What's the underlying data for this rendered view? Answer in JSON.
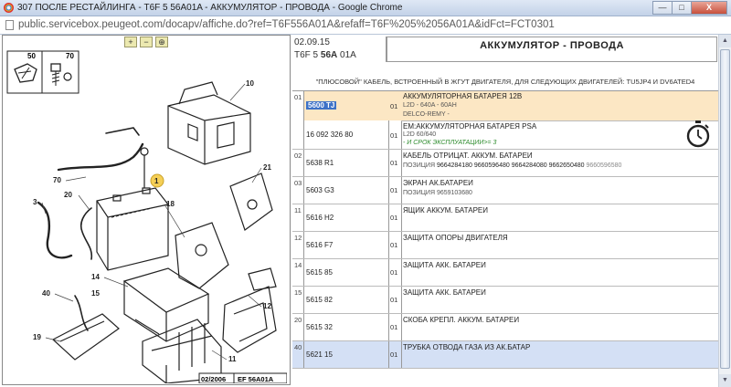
{
  "window": {
    "title": "307 ПОСЛЕ РЕСТАЙЛИНГА - T6F 5 56A01A - АККУМУЛЯТОР - ПРОВОДА - Google Chrome",
    "minimize": "—",
    "maximize": "□",
    "close": "X"
  },
  "address": {
    "url": "public.servicebox.peugeot.com/docapv/affiche.do?ref=T6F556A01A&refaff=T6F%205%2056A01A&idFct=FCT0301"
  },
  "zoom": {
    "zoom_in": "+",
    "zoom_out": "−",
    "reset": "⊕"
  },
  "diagram": {
    "inset_labels": [
      "50",
      "70"
    ],
    "callouts": [
      "10",
      "1",
      "21",
      "70",
      "3",
      "20",
      "18",
      "40",
      "14",
      "15",
      "19",
      "12",
      "11"
    ],
    "footer_date": "02/2006",
    "footer_code": "EF 56A01A"
  },
  "header": {
    "date": "02.09.15",
    "code_prefix": "T6F 5 ",
    "code_bold": "56A",
    "code_suffix": " 01A",
    "title": "АККУМУЛЯТОР - ПРОВОДА"
  },
  "subtitle": "\"ПЛЮСОВОЙ\" КАБЕЛЬ, ВСТРОЕННЫЙ В ЖГУТ ДВИГАТЕЛЯ, ДЛЯ СЛЕДУЮЩИХ ДВИГАТЕЛЕЙ: TU5JP4 И DV6ATED4",
  "parts": [
    {
      "num": "01",
      "ref1": "5600 TJ",
      "qty1": "01",
      "desc1": "АККУМУЛЯТОРНАЯ БАТАРЕЯ 12В",
      "desc1_lines": [
        "L2D - 640A - 60AH",
        "DELCO-REMY -"
      ],
      "ref2": "16 092 326 80",
      "qty2": "01",
      "desc2": "ЕМ:АККУМУЛЯТОРНАЯ БАТАРЕЯ PSA",
      "desc2_line": "L2D 60/640",
      "desc2_note": "- И СРОК ЭКСПЛУАТАЦИИ>= 3"
    },
    {
      "num": "02",
      "ref": "5638 R1",
      "qty": "01",
      "desc": "КАБЕЛЬ ОТРИЦАТ. АККУМ. БАТАРЕИ",
      "extra_prefix": "ПОЗИЦИЯ ",
      "extra_strong": "9664284180 9660596480 9664284080 9662650480",
      "extra_tail": " 9660596580"
    },
    {
      "num": "03",
      "ref": "5603 G3",
      "qty": "01",
      "desc": "ЭКРАН АК.БАТАРЕИ",
      "extra_prefix": "ПОЗИЦИЯ 9659103680"
    },
    {
      "num": "11",
      "ref": "5616 H2",
      "qty": "01",
      "desc": "ЯЩИК АККУМ. БАТАРЕИ"
    },
    {
      "num": "12",
      "ref": "5616 F7",
      "qty": "01",
      "desc": "ЗАЩИТА ОПОРЫ ДВИГАТЕЛЯ"
    },
    {
      "num": "14",
      "ref": "5615 85",
      "qty": "01",
      "desc": "ЗАЩИТА АКК. БАТАРЕИ"
    },
    {
      "num": "15",
      "ref": "5615 82",
      "qty": "01",
      "desc": "ЗАЩИТА АКК. БАТАРЕИ"
    },
    {
      "num": "20",
      "ref": "5615 32",
      "qty": "01",
      "desc": "СКОБА КРЕПЛ. АККУМ. БАТАРЕИ"
    },
    {
      "num": "40",
      "ref": "5621 15",
      "qty": "01",
      "desc": "ТРУБКА ОТВОДА ГАЗА ИЗ АК.БАТАР"
    }
  ],
  "scroll": {
    "up": "▲",
    "down": "▼"
  },
  "colors": {
    "highlight_row": "#fce7c4",
    "selected_row": "#d4e0f5",
    "ref_selection": "#3d72c7",
    "callout_marker": "#f5cf56",
    "note_green": "#2a8a2a"
  }
}
